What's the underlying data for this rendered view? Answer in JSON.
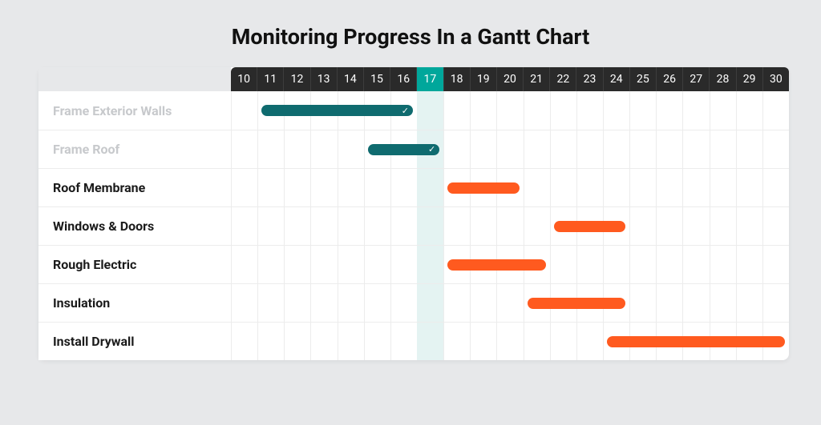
{
  "title": "Monitoring Progress In a Gantt Chart",
  "chart_data": {
    "type": "gantt",
    "title": "Monitoring Progress In a Gantt Chart",
    "x": [
      10,
      11,
      12,
      13,
      14,
      15,
      16,
      17,
      18,
      19,
      20,
      21,
      22,
      23,
      24,
      25,
      26,
      27,
      28,
      29,
      30
    ],
    "today": 17,
    "tasks": [
      {
        "name": "Frame Exterior Walls",
        "start": 11,
        "end": 16,
        "status": "done"
      },
      {
        "name": "Frame Roof",
        "start": 15,
        "end": 17,
        "status": "done"
      },
      {
        "name": "Roof Membrane",
        "start": 18,
        "end": 20,
        "status": "todo"
      },
      {
        "name": "Windows & Doors",
        "start": 22,
        "end": 24,
        "status": "todo"
      },
      {
        "name": "Rough Electric",
        "start": 18,
        "end": 21,
        "status": "todo"
      },
      {
        "name": "Insulation",
        "start": 21,
        "end": 24,
        "status": "todo"
      },
      {
        "name": "Install Drywall",
        "start": 24,
        "end": 30,
        "status": "todo"
      }
    ],
    "colors": {
      "done": "#0f6b6f",
      "todo": "#ff5a1f",
      "today": "#00a79b"
    }
  },
  "icons": {
    "check": "✓"
  }
}
